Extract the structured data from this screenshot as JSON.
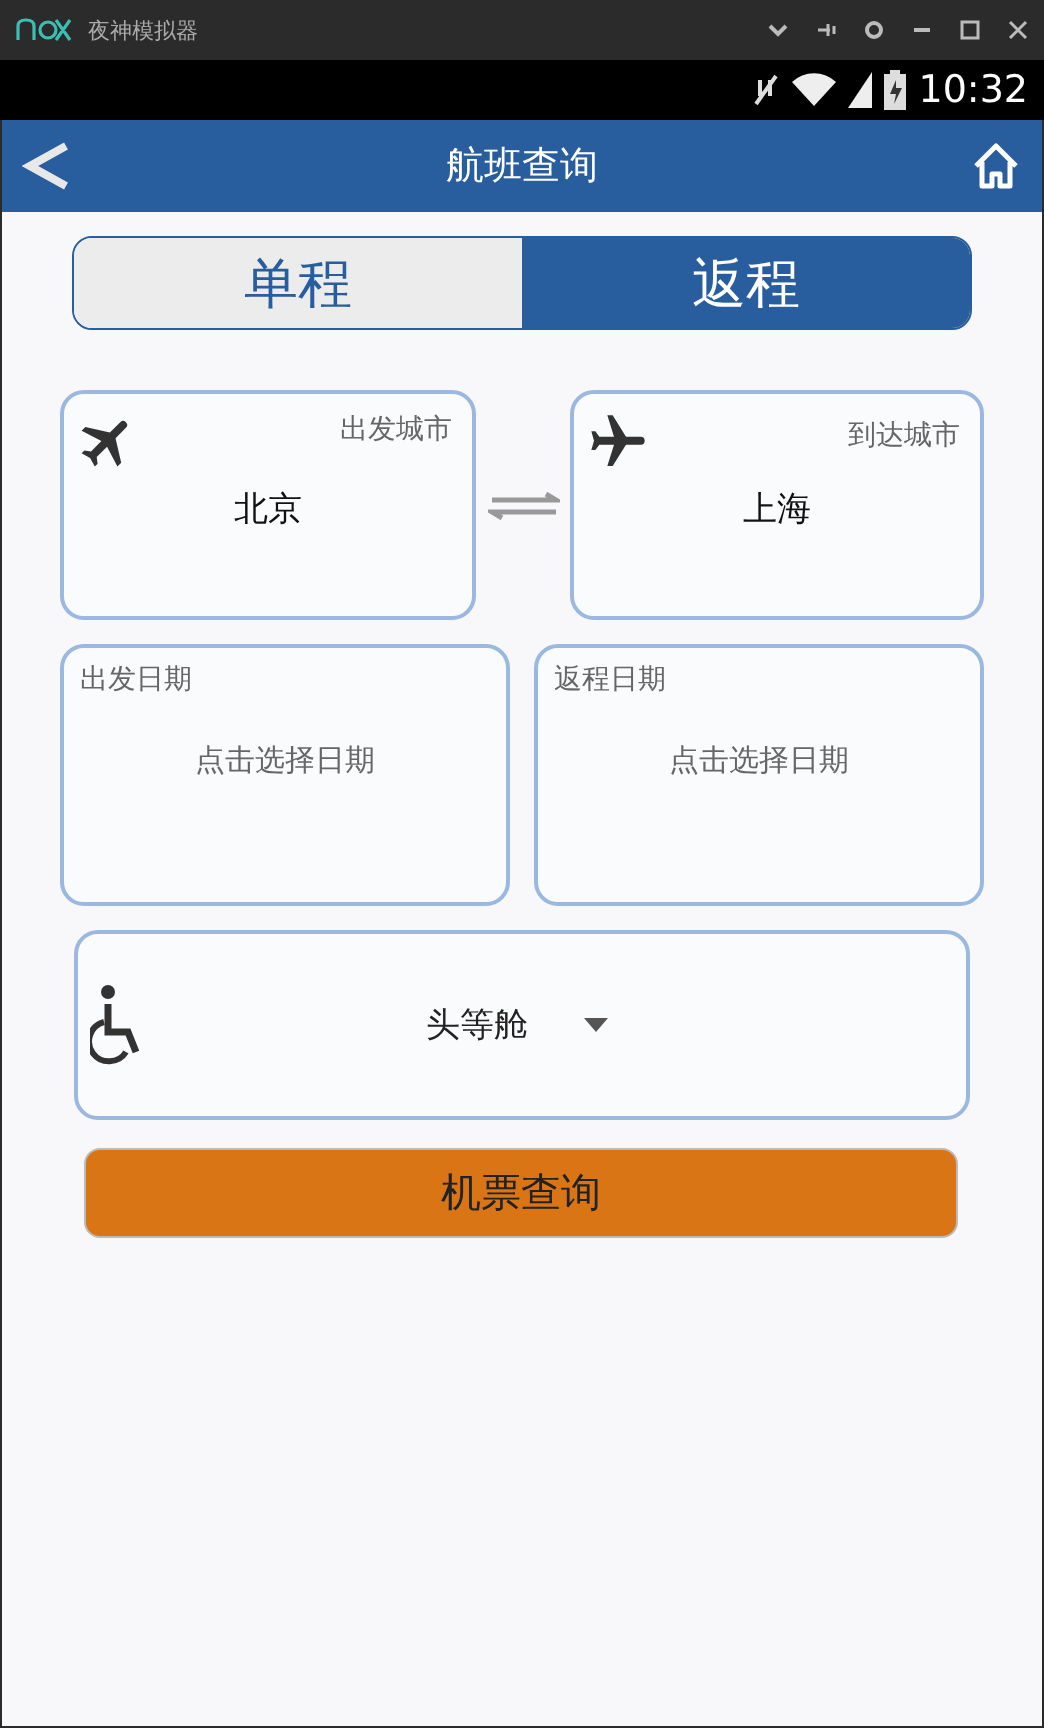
{
  "emulator": {
    "title": "夜神模拟器"
  },
  "status_bar": {
    "time": "10:32"
  },
  "app_bar": {
    "title": "航班查询"
  },
  "trip_tabs": [
    {
      "label": "单程",
      "selected": false
    },
    {
      "label": "返程",
      "selected": true
    }
  ],
  "cities": [
    {
      "label": "出发城市",
      "value": "北京",
      "kind": "departure"
    },
    {
      "label": "到达城市",
      "value": "上海",
      "kind": "arrival"
    }
  ],
  "dates": [
    {
      "label": "出发日期",
      "placeholder": "点击选择日期"
    },
    {
      "label": "返程日期",
      "placeholder": "点击选择日期"
    }
  ],
  "cabin": {
    "value": "头等舱"
  },
  "search_button": "机票查询"
}
